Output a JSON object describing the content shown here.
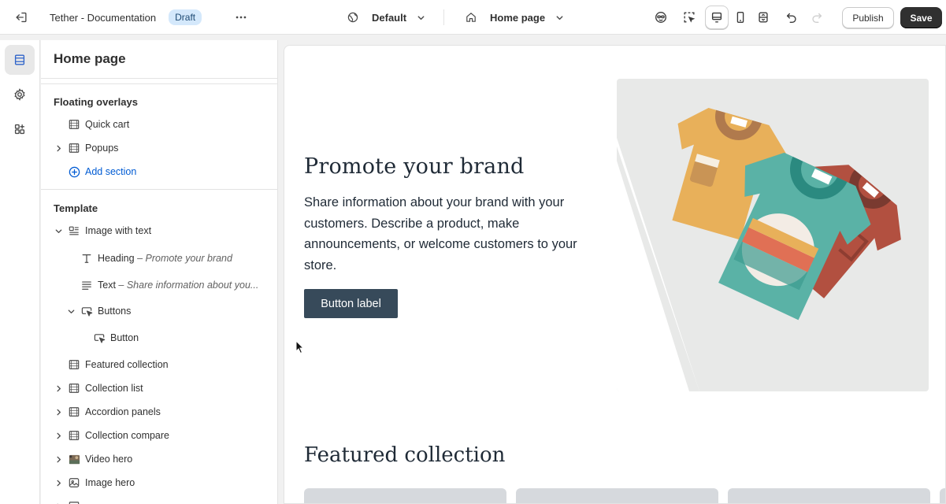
{
  "topbar": {
    "app_title": "Tether - Documentation",
    "status_badge": "Draft",
    "theme_selector": "Default",
    "page_selector": "Home page",
    "publish_label": "Publish",
    "save_label": "Save"
  },
  "sidebar": {
    "title": "Home page",
    "floating_overlays": {
      "title": "Floating overlays",
      "items": [
        {
          "label": "Quick cart"
        },
        {
          "label": "Popups"
        }
      ],
      "add_section": "Add section"
    },
    "template": {
      "title": "Template",
      "image_with_text": "Image with text",
      "heading_label": "Heading",
      "heading_sub": "– Promote your brand",
      "text_label": "Text",
      "text_sub": "– Share information about you...",
      "buttons_label": "Buttons",
      "button_label": "Button",
      "sections": [
        {
          "label": "Featured collection"
        },
        {
          "label": "Collection list"
        },
        {
          "label": "Accordion panels"
        },
        {
          "label": "Collection compare"
        },
        {
          "label": "Video hero"
        },
        {
          "label": "Image hero"
        }
      ]
    }
  },
  "preview": {
    "hero_heading": "Promote your brand",
    "hero_text": "Share information about your brand with your customers. Describe a product, make announcements, or welcome customers to your store.",
    "hero_button": "Button label",
    "featured_heading": "Featured collection"
  },
  "colors": {
    "accent_link": "#005bd3",
    "save_button": "#303030",
    "hero_button": "#374a5a",
    "badge_bg": "#d4e8fb"
  }
}
